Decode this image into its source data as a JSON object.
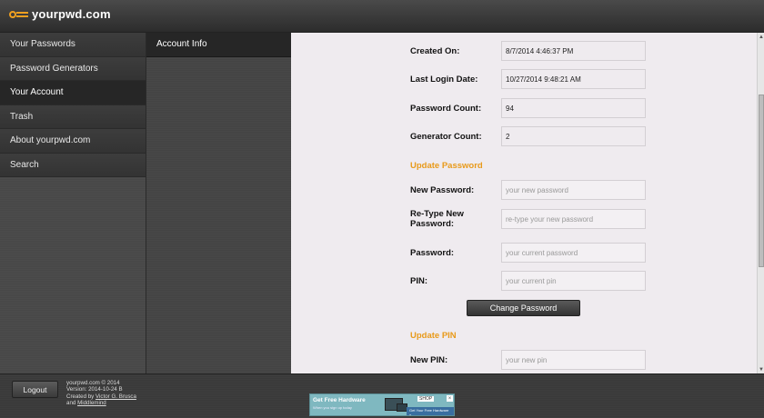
{
  "header": {
    "logo_text": "yourpwd.com"
  },
  "sidebar": {
    "items": [
      {
        "label": "Your Passwords"
      },
      {
        "label": "Password Generators"
      },
      {
        "label": "Your Account"
      },
      {
        "label": "Trash"
      },
      {
        "label": "About yourpwd.com"
      },
      {
        "label": "Search"
      }
    ],
    "active": "Your Account"
  },
  "subnav": {
    "items": [
      {
        "label": "Account Info"
      }
    ]
  },
  "account": {
    "created_on": {
      "label": "Created On:",
      "value": "8/7/2014 4:46:37 PM"
    },
    "last_login": {
      "label": "Last Login Date:",
      "value": "10/27/2014 9:48:21 AM"
    },
    "password_count": {
      "label": "Password Count:",
      "value": "94"
    },
    "generator_count": {
      "label": "Generator Count:",
      "value": "2"
    }
  },
  "update_password": {
    "heading": "Update Password",
    "new_password": {
      "label": "New Password:",
      "placeholder": "your new password"
    },
    "retype_password": {
      "label": "Re-Type New Password:",
      "placeholder": "re-type your new password"
    },
    "current_password": {
      "label": "Password:",
      "placeholder": "your current password"
    },
    "pin": {
      "label": "PIN:",
      "placeholder": "your current pin"
    },
    "button_label": "Change Password"
  },
  "update_pin": {
    "heading": "Update PIN",
    "new_pin": {
      "label": "New PIN:",
      "placeholder": "your new pin"
    }
  },
  "footer": {
    "logout_label": "Logout",
    "copyright": "yourpwd.com © 2014",
    "version": "Version: 2014-10-24 B",
    "created_by_prefix": "Created by",
    "author_link": "Victor G. Brusca",
    "and_text": "and",
    "company_link": "Middlemind"
  },
  "ad": {
    "headline": "Get Free Hardware",
    "subline": "When you sign up today",
    "shop_label": "SHOP",
    "cta": "Get Your Free Hardware »"
  },
  "colors": {
    "accent": "#e89a1a",
    "content_bg": "#efebef",
    "sidebar_bg": "#474747",
    "active_item": "#262626"
  }
}
